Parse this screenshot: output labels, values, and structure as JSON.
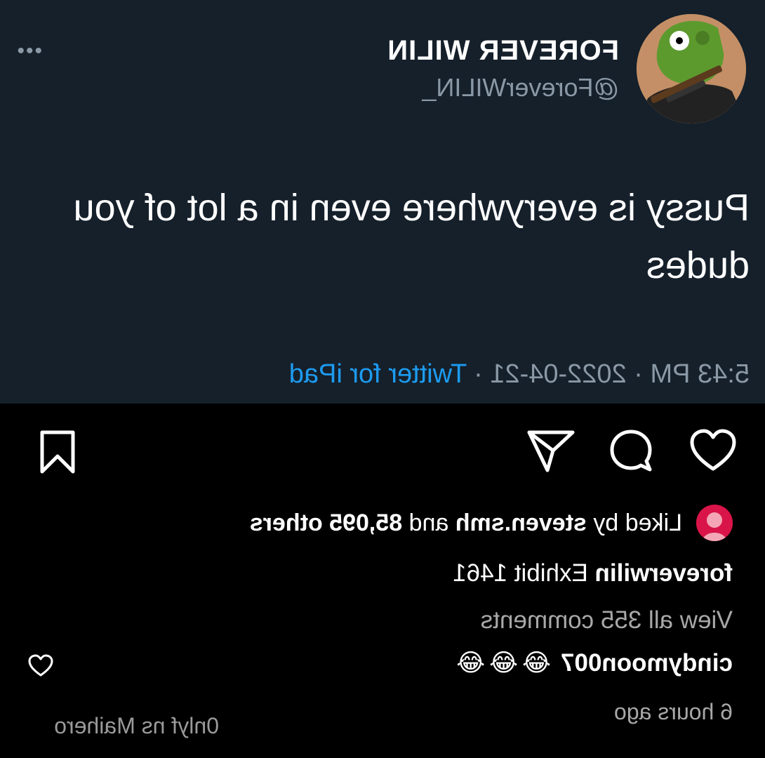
{
  "tweet": {
    "display_name": "FOREVER WILIN",
    "handle": "@ForeverWILIN_",
    "more_icon": "more-dots-icon",
    "text": "Pussy is everywhere even in a lot of you dudes",
    "time": "5:43 PM",
    "date": "2022-04-21",
    "separator": "·",
    "source": "Twitter for iPad",
    "background_color": "#15202b",
    "link_color": "#1d9bf0"
  },
  "post": {
    "actions": {
      "like_icon": "heart-icon",
      "comment_icon": "comment-bubble-icon",
      "share_icon": "paper-plane-icon",
      "save_icon": "bookmark-icon"
    },
    "likes": {
      "prefix": "Liked by ",
      "user": "steven.smh",
      "middle": " and ",
      "count": "85,095 others"
    },
    "caption": {
      "user": "foreverwilin",
      "text": "Exhibit 1461"
    },
    "view_all_comments": "View all 355 comments",
    "top_comment": {
      "user": "cindymoon007",
      "emojis": [
        "😂",
        "😂",
        "😂"
      ]
    },
    "time_ago": "6 hours ago"
  },
  "watermark": "0nlyf ns Maihero"
}
